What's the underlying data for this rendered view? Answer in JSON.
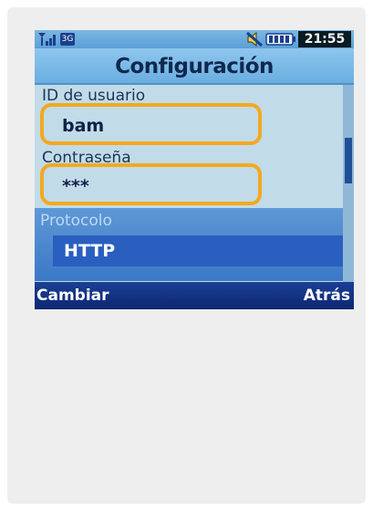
{
  "status_bar": {
    "signal_icon": "signal-bars-icon",
    "network_badge": "3G",
    "mute_icon": "mute-icon",
    "battery_icon": "battery-icon",
    "time": "21:55"
  },
  "screen": {
    "title": "Configuración"
  },
  "fields": {
    "user_id": {
      "label": "ID de usuario",
      "value": "bam"
    },
    "password": {
      "label": "Contraseña",
      "value": "***"
    },
    "protocol": {
      "label": "Protocolo",
      "value": "HTTP"
    }
  },
  "softkeys": {
    "left": "Cambiar",
    "right": "Atrás"
  },
  "colors": {
    "highlight_outline": "#f3a91e",
    "selected_row": "#2a5fc0",
    "softkey_bar": "#1b3f95"
  }
}
